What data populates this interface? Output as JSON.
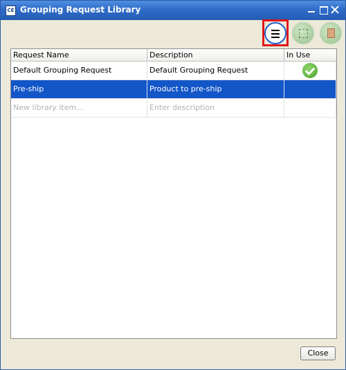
{
  "window": {
    "title": "Grouping Request Library",
    "app_icon_text": "CE"
  },
  "toolbar": {
    "buttons": [
      {
        "icon": "hamburger-menu-icon"
      },
      {
        "icon": "selection-frame-icon"
      },
      {
        "icon": "package-box-icon"
      }
    ]
  },
  "table": {
    "headers": [
      "Request Name",
      "Description",
      "In Use"
    ],
    "rows": [
      {
        "name": "Default Grouping Request",
        "description": "Default Grouping Request",
        "in_use": true
      },
      {
        "name": "Pre-ship",
        "description": "Product to pre-ship",
        "in_use": false,
        "selected": true
      }
    ],
    "new_row": {
      "name_placeholder": "New library item...",
      "description_placeholder": "Enter description"
    }
  },
  "footer": {
    "close_label": "Close"
  },
  "colors": {
    "selection": "#1356c8",
    "check": "#4aa32b",
    "title_bar": "#2f6cc9"
  }
}
